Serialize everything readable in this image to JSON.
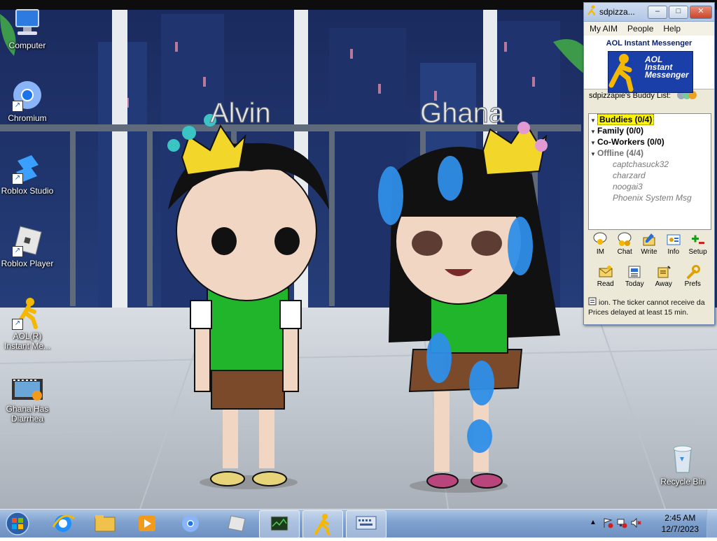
{
  "desktop": {
    "wallpaper_text": {
      "name_left": "Alvin",
      "name_right": "Ghana"
    },
    "icons": [
      {
        "label": "Computer"
      },
      {
        "label": "Chromium"
      },
      {
        "label": "Roblox Studio"
      },
      {
        "label": "Roblox Player"
      },
      {
        "label": "AOL(R) Instant Me..."
      },
      {
        "label": "Ghana Has Diarrhea"
      },
      {
        "label": "Recycle Bin"
      }
    ]
  },
  "aim": {
    "title": "sdpizza...",
    "menu": [
      "My AIM",
      "People",
      "Help"
    ],
    "brand": "AOL Instant Messenger",
    "logo_line1": "AOL",
    "logo_line2": "Instant",
    "logo_line3": "Messenger",
    "buddy_list_title": "sdpizzapie's Buddy List:",
    "groups": [
      {
        "label": "Buddies (0/4)"
      },
      {
        "label": "Family (0/0)"
      },
      {
        "label": "Co-Workers (0/0)"
      },
      {
        "label": "Offline (4/4)"
      }
    ],
    "offline_buddies": [
      "captchasuck32",
      "charzard",
      "noogai3",
      "Phoenix System Msg"
    ],
    "toolbar1": [
      "IM",
      "Chat",
      "Write",
      "Info",
      "Setup"
    ],
    "toolbar2": [
      "Read",
      "Today",
      "Away",
      "Prefs"
    ],
    "ticker_line1": "ion.  The ticker cannot receive da",
    "ticker_line2": "Prices delayed at least 15 min.",
    "colors": {
      "selected_group_bg": "#fff700",
      "brand_blue": "#1b3fa8",
      "logo_yellow": "#f5b800"
    }
  },
  "taskbar": {
    "clock_time": "2:45 AM",
    "clock_date": "12/7/2023"
  }
}
